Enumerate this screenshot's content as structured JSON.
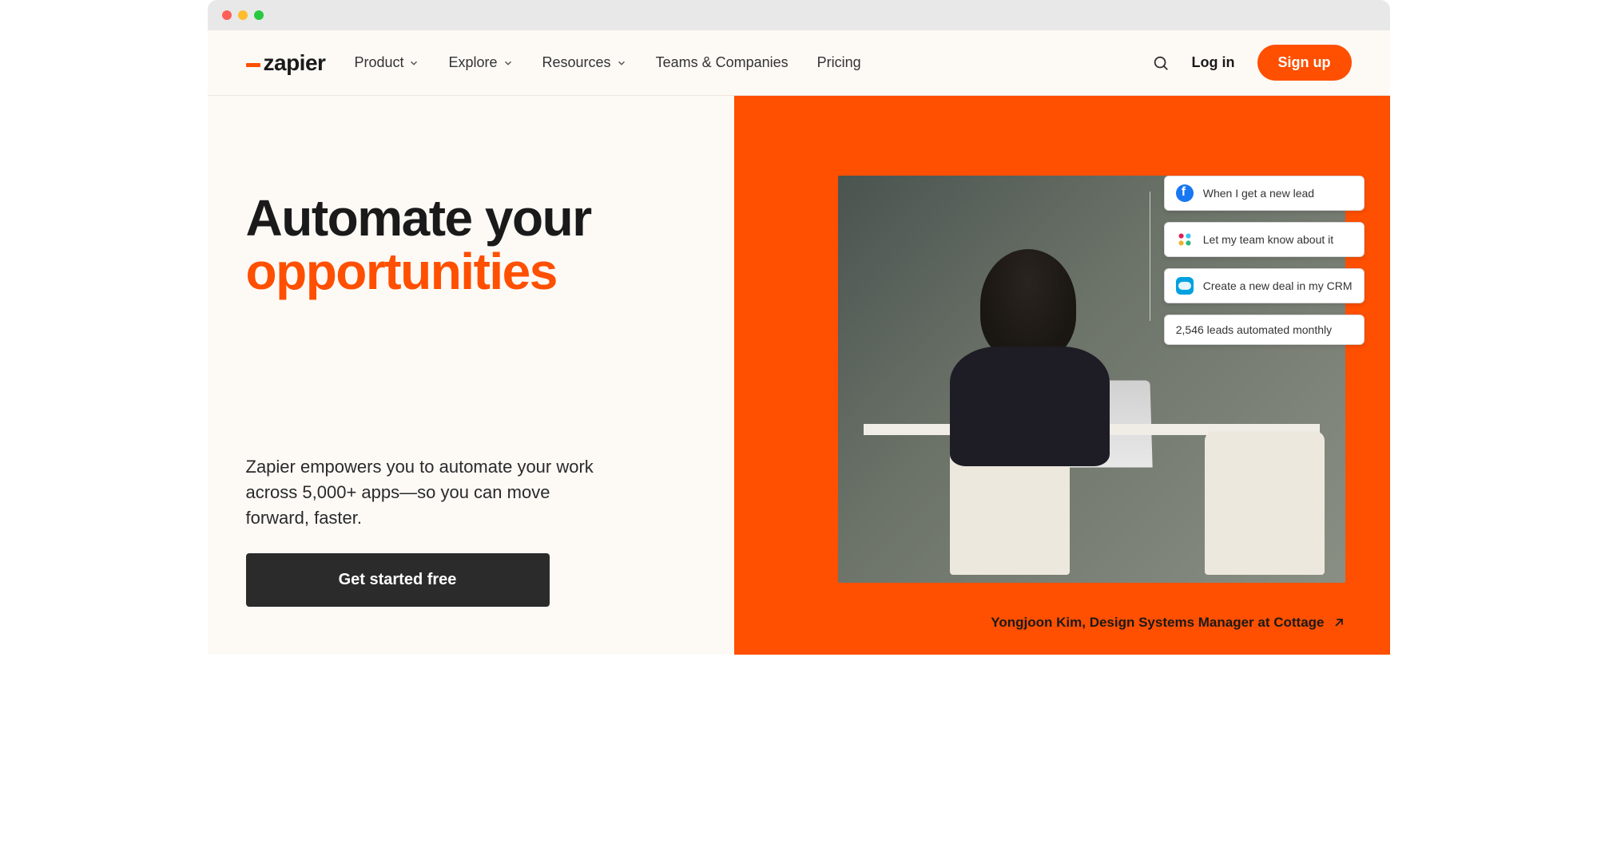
{
  "brand": {
    "name": "zapier"
  },
  "nav": {
    "items": [
      {
        "label": "Product",
        "has_dropdown": true
      },
      {
        "label": "Explore",
        "has_dropdown": true
      },
      {
        "label": "Resources",
        "has_dropdown": true
      },
      {
        "label": "Teams & Companies",
        "has_dropdown": false
      },
      {
        "label": "Pricing",
        "has_dropdown": false
      }
    ],
    "login": "Log in",
    "signup": "Sign up"
  },
  "hero": {
    "headline_line1": "Automate your",
    "headline_line2": "opportunities",
    "subhead": "Zapier empowers you to automate your work across 5,000+ apps—so you can move forward, faster.",
    "cta": "Get started free"
  },
  "overlay_cards": [
    {
      "icon": "facebook",
      "text": "When I get a new lead"
    },
    {
      "icon": "slack",
      "text": "Let my team know about it"
    },
    {
      "icon": "salesforce",
      "text": "Create a new deal in my CRM"
    },
    {
      "icon": "",
      "text": "2,546 leads automated monthly"
    }
  ],
  "caption": "Yongjoon Kim, Design Systems Manager at Cottage",
  "colors": {
    "accent": "#ff4f00",
    "dark": "#2b2b2b"
  }
}
